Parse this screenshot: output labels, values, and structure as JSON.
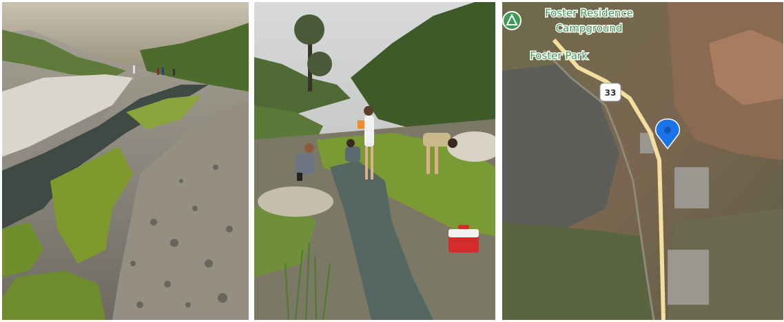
{
  "photos": [
    {
      "name": "creek-bed-photo"
    },
    {
      "name": "students-sampling-photo"
    }
  ],
  "map": {
    "labels": {
      "campground_line1": "Foster Residence",
      "campground_line2": "Campground",
      "park": "Foster Park",
      "highway": "33"
    },
    "icons": [
      "campground-pin-icon",
      "location-marker-icon"
    ],
    "colors": {
      "label": "#3f9a54",
      "marker": "#1a73e8",
      "road": "#f3e0a0"
    }
  }
}
